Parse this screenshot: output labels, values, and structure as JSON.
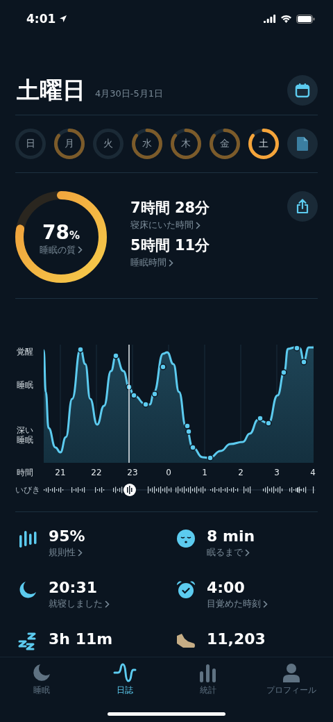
{
  "status_bar": {
    "time": "4:01"
  },
  "header": {
    "title": "土曜日",
    "date_range": "4月30日-5月1日"
  },
  "days": [
    {
      "label": "日",
      "filled": false,
      "selected": false
    },
    {
      "label": "月",
      "filled": true,
      "selected": false
    },
    {
      "label": "火",
      "filled": false,
      "selected": false
    },
    {
      "label": "水",
      "filled": true,
      "selected": false
    },
    {
      "label": "木",
      "filled": true,
      "selected": false
    },
    {
      "label": "金",
      "filled": true,
      "selected": false
    },
    {
      "label": "土",
      "filled": true,
      "selected": true
    }
  ],
  "summary": {
    "quality": {
      "value": "78",
      "unit": "%",
      "label": "睡眠の質"
    },
    "stats": [
      {
        "value": "7時間 28分",
        "label": "寝床にいた時間"
      },
      {
        "value": "5時間 11分",
        "label": "睡眠時間"
      }
    ]
  },
  "chart": {
    "y_labels": [
      "覚醒",
      "睡眠",
      "深い睡眠"
    ],
    "x_label": "時間",
    "x_ticks": [
      "21",
      "22",
      "23",
      "0",
      "1",
      "2",
      "3",
      "4"
    ],
    "snore_label": "いびき"
  },
  "metrics": [
    {
      "kind": "regularity",
      "value": "95%",
      "label": "規則性"
    },
    {
      "kind": "fall_asleep",
      "value": "8 min",
      "label": "眠るまで"
    },
    {
      "kind": "bedtime",
      "value": "20:31",
      "label": "就寝しました"
    },
    {
      "kind": "wake",
      "value": "4:00",
      "label": "目覚めた時刻"
    },
    {
      "kind": "snore",
      "value": "3h 11m"
    },
    {
      "kind": "steps",
      "value": "11,203"
    }
  ],
  "tabs": [
    {
      "kind": "sleep",
      "label": "睡眠",
      "selected": false
    },
    {
      "kind": "journal",
      "label": "日誌",
      "selected": true
    },
    {
      "kind": "stats",
      "label": "統計",
      "selected": false
    },
    {
      "kind": "profile",
      "label": "プロフィール",
      "selected": false
    }
  ]
}
